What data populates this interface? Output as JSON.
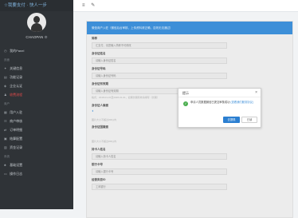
{
  "sidebar": {
    "brand": "☆我要支付 · 快人一步",
    "username": "CHAOPAN",
    "user_icon": "gear-icon",
    "items_top": [
      {
        "label": "我的Panel"
      }
    ],
    "section_a": "页面",
    "items_a": [
      {
        "label": "关键信息"
      },
      {
        "label": "功能记录"
      },
      {
        "label": "企业认证"
      },
      {
        "label": "收费流程"
      }
    ],
    "section_b": "商户",
    "items_b": [
      {
        "label": "用户入驻"
      },
      {
        "label": "商户审核"
      },
      {
        "label": "订单明细"
      },
      {
        "label": "结算配置"
      },
      {
        "label": "资金记录"
      }
    ],
    "section_c": "系统",
    "items_c": [
      {
        "label": "基础设置"
      },
      {
        "label": "操作日志"
      }
    ]
  },
  "topbar": {
    "menu_icon": "≡",
    "edit_icon": "✎"
  },
  "form": {
    "banner": "微信商户入驻（微信后台审核，上传资料请正确，否则无法通过）",
    "fields": [
      {
        "label": "简称",
        "value": "汇支付、请您输入简称不可修改"
      },
      {
        "label": "身份证姓名",
        "value": "请输入身份证姓名"
      },
      {
        "label": "身份证号码",
        "value": "请输入身份证号码"
      },
      {
        "label": "身份证有效期",
        "value": "请输入身份证有效期"
      }
    ],
    "hint_1": "格式：2018-01-01至2028-01-01，如果长期有效请填写（长期）",
    "label_2": "身份证人像面",
    "hint_2": "图片大小不超过2M以内",
    "label_3": "身份证国徽面",
    "hint_3": "图片大小不超过2M以内",
    "field_4": {
      "label": "持卡人姓名",
      "value": "请输入持卡人姓名"
    },
    "field_5": {
      "label": "银行卡号",
      "value": "请输入银行卡号"
    },
    "field_6": {
      "label": "经营类目ID",
      "value": "工商银行"
    }
  },
  "dialog": {
    "title": "提示",
    "close": "×",
    "message": "申请人员数据微信已提交审核成功",
    "link": "(查看我们服务协议)",
    "confirm": "去提现",
    "cancel": "已读"
  }
}
